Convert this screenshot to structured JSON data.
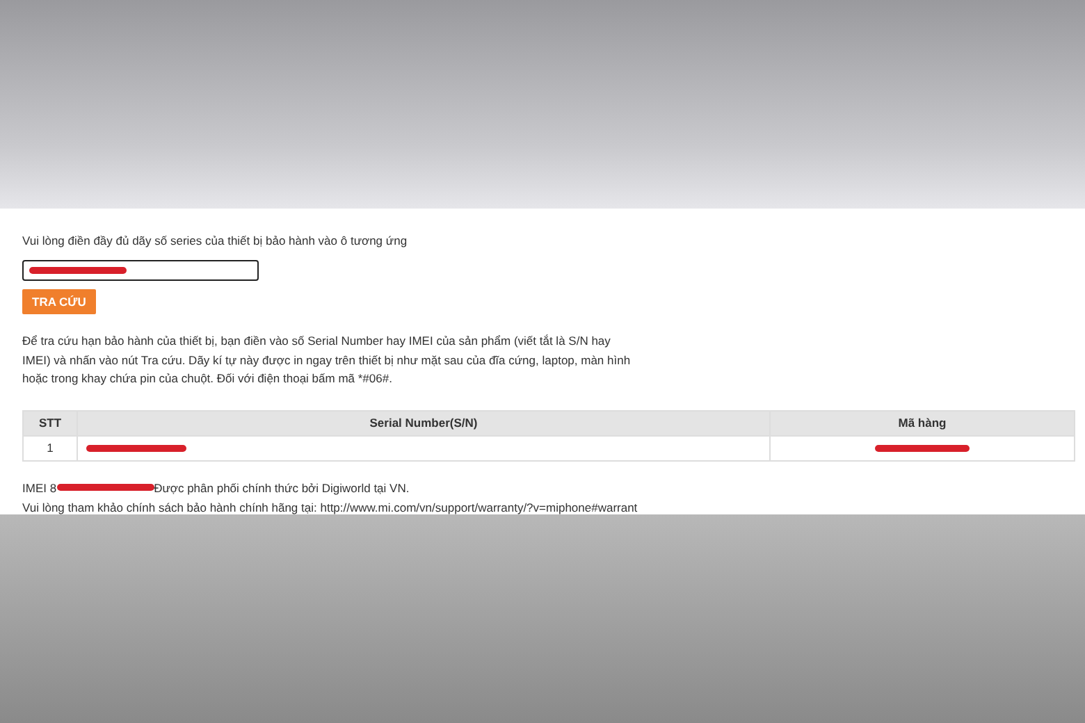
{
  "form": {
    "instruction": "Vui lòng điền đầy đủ dãy số series của thiết bị bảo hành vào ô tương ứng",
    "search_button": "TRA CỨU",
    "help_text": "Để tra cứu hạn bảo hành của thiết bị, bạn điền vào số Serial Number hay IMEI của sản phẩm (viết tắt là S/N hay IMEI) và nhấn vào nút Tra cứu. Dãy kí tự này được in ngay trên thiết bị như mặt sau của đĩa cứng, laptop, màn hình hoặc trong khay chứa pin của chuột. Đối với điện thoại bấm mã *#06#."
  },
  "table": {
    "columns": [
      "STT",
      "Serial Number(S/N)",
      "Mã hàng"
    ],
    "rows": [
      {
        "stt": "1"
      }
    ]
  },
  "result": {
    "imei_prefix": "IMEI 8",
    "distributor_text": "Được phân phối chính thức bởi Digiworld tại VN.",
    "policy_text": "Vui lòng tham khảo chính sách bảo hành chính hãng tại: http://www.mi.com/vn/support/warranty/?v=miphone#warrant"
  }
}
